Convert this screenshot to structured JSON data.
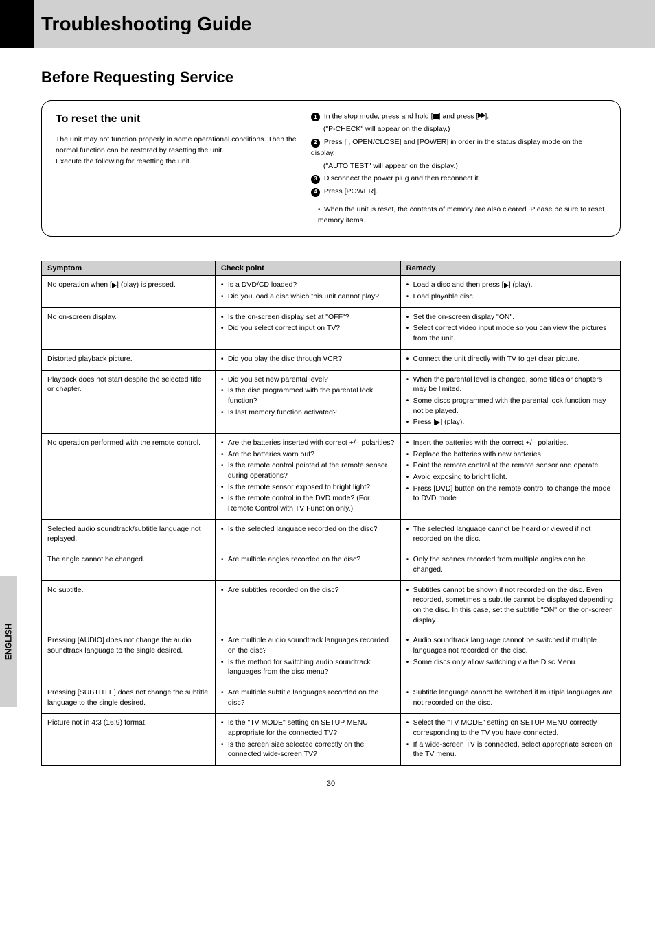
{
  "page_number": "30",
  "header": "Troubleshooting Guide",
  "side_tab": "ENGLISH",
  "section_title": "Before Requesting Service",
  "reset_box": {
    "title": "To reset the unit",
    "intro": "The unit may not function properly in some operational conditions. Then the normal function can be restored by resetting the unit.",
    "execute": "Execute the following for resetting the unit.",
    "steps": [
      {
        "n": "1",
        "text_a": "In the stop mode, press and hold [",
        "text_b": "] and press ["
      },
      {
        "n": "2",
        "text_before": "Press [",
        "text_main": ", OPEN/CLOSE] and [POWER] in order in the status display mode on the display."
      },
      {
        "n": "3",
        "text": "Disconnect the power plug and then reconnect it."
      },
      {
        "n": "4",
        "text": "Press [POWER]."
      }
    ],
    "after_step1": "].",
    "indent1": "(\"P-CHECK\" will appear on the display.)",
    "indent2": "(\"AUTO TEST\" will appear on the display.)",
    "note_bullet": "•",
    "note": "When the unit is reset, the contents of memory are also cleared. Please be sure to reset memory items."
  },
  "table": {
    "headers": [
      "Symptom",
      "Check point",
      "Remedy"
    ],
    "rows": [
      {
        "symptom_text_before": "No operation when [",
        "symptom_text_after": "] (play) is pressed.",
        "checks": [
          "Is a DVD/CD loaded?",
          "Did you load a disc which this unit cannot play?"
        ],
        "remedies": [
          {
            "text_before": "Load a disc and then press [",
            "text_after": "] (play)."
          },
          {
            "text": "Load playable disc."
          }
        ]
      },
      {
        "symptom": "No on-screen display.",
        "checks": [
          "Is the on-screen display set at \"OFF\"?",
          "Did you select correct input on TV?"
        ],
        "remedies": [
          {
            "text": "Set the on-screen display \"ON\"."
          },
          {
            "text": "Select correct video input mode so you can view the pictures from the unit."
          }
        ]
      },
      {
        "symptom": "Distorted playback picture.",
        "checks": [
          "Did you play the disc through VCR?"
        ],
        "remedies": [
          {
            "text": "Connect the unit directly with TV to get clear picture."
          }
        ]
      },
      {
        "symptom": "Playback does not start despite the selected title or chapter.",
        "checks": [
          "Did you set new parental level?",
          "Is the disc programmed with the parental lock function?",
          "Is last memory function activated?"
        ],
        "remedies": [
          {
            "text": "When the parental level is changed, some titles or chapters may be limited."
          },
          {
            "text": "Some discs programmed with the parental lock function may not be played."
          },
          {
            "text_before": "Press [",
            "text_after": "] (play)."
          }
        ]
      },
      {
        "symptom": "No operation performed with the remote control.",
        "checks": [
          "Are the batteries inserted with correct +/– polarities?",
          "Are the batteries worn out?",
          "Is the remote control pointed at the remote sensor during operations?",
          "Is the remote sensor exposed to bright light?",
          "Is the remote control in the DVD mode? (For Remote Control with TV Function only.)"
        ],
        "remedies": [
          {
            "text": "Insert the batteries with the correct +/– polarities."
          },
          {
            "text": "Replace the batteries with new batteries."
          },
          {
            "text": "Point the remote control at the remote sensor and operate."
          },
          {
            "text": "Avoid exposing to bright light."
          },
          {
            "text": "Press [DVD] button on the remote control to change the mode to DVD mode."
          }
        ]
      },
      {
        "symptom": "Selected audio soundtrack/subtitle language not replayed.",
        "checks": [
          "Is the selected language recorded on the disc?"
        ],
        "remedies": [
          {
            "text": "The selected language cannot be heard or viewed if not recorded on the disc."
          }
        ]
      },
      {
        "symptom": "The angle cannot be changed.",
        "checks": [
          "Are multiple angles recorded on the disc?"
        ],
        "remedies": [
          {
            "text": "Only the scenes recorded from multiple angles can be changed."
          }
        ]
      },
      {
        "symptom": "No subtitle.",
        "checks": [
          "Are subtitles recorded on the disc?"
        ],
        "remedies": [
          {
            "text": "Subtitles cannot be shown if not recorded on the disc. Even recorded, sometimes a subtitle cannot be displayed depending on the disc. In this case, set the subtitle \"ON\" on the on-screen display."
          }
        ]
      },
      {
        "symptom": "Pressing [AUDIO] does not change the audio soundtrack language to the single desired.",
        "checks": [
          "Are multiple audio soundtrack languages recorded on the disc?",
          "Is the method for switching audio soundtrack languages from the disc menu?"
        ],
        "remedies": [
          {
            "text": "Audio soundtrack language cannot be switched if multiple languages not recorded on the disc."
          },
          {
            "text": "Some discs only allow switching via the Disc Menu."
          }
        ]
      },
      {
        "symptom": "Pressing [SUBTITLE] does not change the subtitle language to the single desired.",
        "checks": [
          "Are multiple subtitle languages recorded on the disc?"
        ],
        "remedies": [
          {
            "text": "Subtitle language cannot be switched if multiple languages are not recorded on the disc."
          }
        ]
      },
      {
        "symptom": "Picture not in 4:3 (16:9) format.",
        "checks": [
          "Is the \"TV MODE\" setting on SETUP MENU appropriate for the connected TV?",
          "Is the screen size selected correctly on the connected wide-screen TV?"
        ],
        "remedies": [
          {
            "text": "Select the \"TV MODE\" setting on SETUP MENU correctly corresponding to the TV you have connected."
          },
          {
            "text": "If a wide-screen TV is connected, select appropriate screen on the TV menu."
          }
        ]
      }
    ]
  }
}
